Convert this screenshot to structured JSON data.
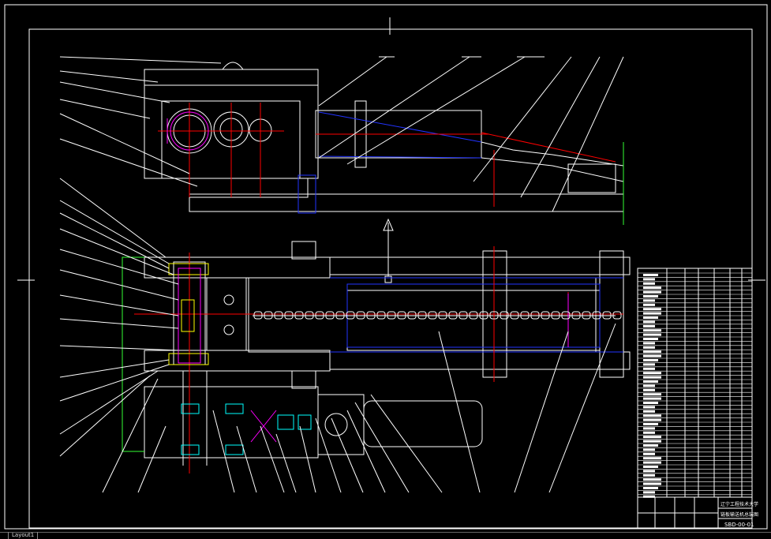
{
  "title_block": {
    "org_line1": "辽宁工程技术大学",
    "org_line2": "链板输送机总装图",
    "drawing_no": "SBD-00-01"
  },
  "layout_tab": "Layout1",
  "colors": {
    "background": "#000000",
    "outline": "#ffffff",
    "centerline": "#ff0000",
    "hidden": "#2233ff",
    "highlight": "#ff00ff",
    "detail": "#00ffff",
    "border": "#33ff33",
    "hatch": "#ffff00"
  }
}
